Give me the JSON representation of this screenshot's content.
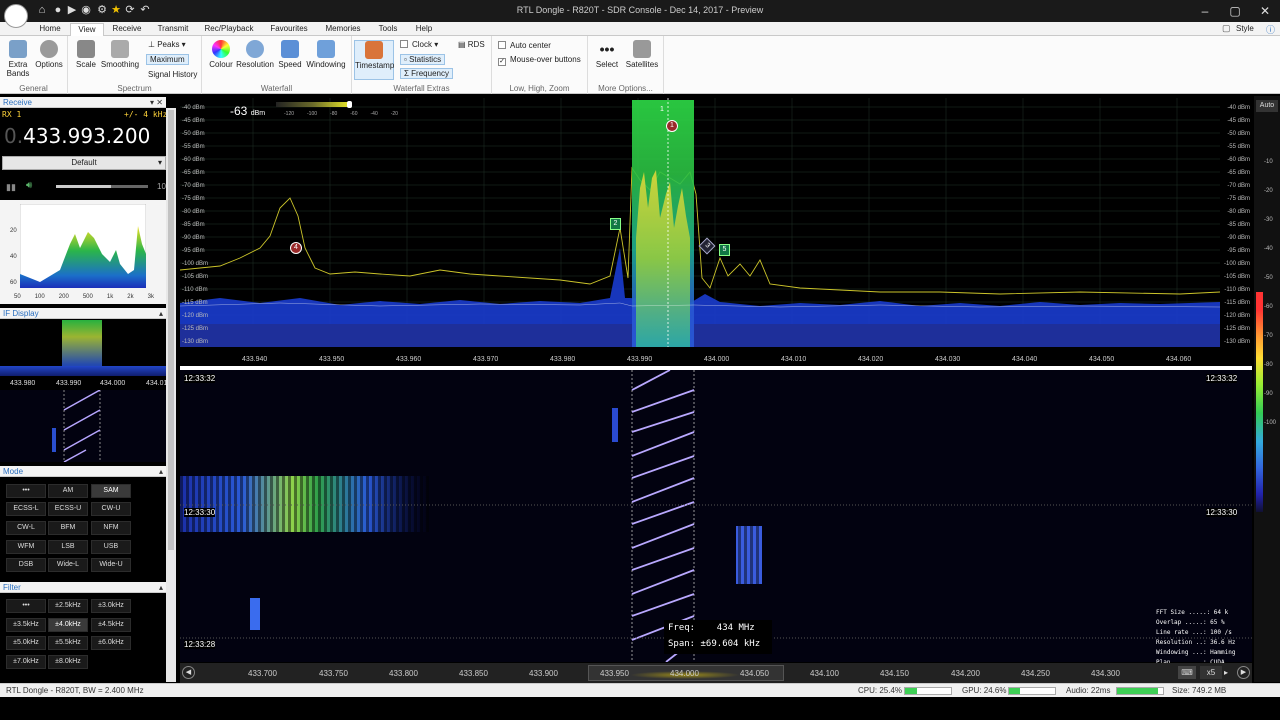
{
  "window": {
    "title": "RTL Dongle - R820T - SDR Console - Dec 14, 2017 - Preview"
  },
  "tabs": [
    "Home",
    "View",
    "Receive",
    "Transmit",
    "Rec/Playback",
    "Favourites",
    "Memories",
    "Tools",
    "Help"
  ],
  "active_tab": "View",
  "style_label": "Style",
  "ribbon": {
    "general": {
      "label": "General",
      "extra_bands": "Extra Bands",
      "options": "Options"
    },
    "spectrum": {
      "label": "Spectrum",
      "scale": "Scale",
      "smoothing": "Smoothing",
      "peaks": "Peaks",
      "maximum": "Maximum",
      "signal_history": "Signal History"
    },
    "waterfall": {
      "label": "Waterfall",
      "colour": "Colour",
      "resolution": "Resolution",
      "speed": "Speed",
      "windowing": "Windowing"
    },
    "waterfall_extras": {
      "label": "Waterfall Extras",
      "timestamp": "Timestamp",
      "clock": "Clock",
      "statistics": "Statistics",
      "frequency": "Frequency",
      "rds": "RDS"
    },
    "zoom": {
      "label": "Low, High, Zoom",
      "auto_center": "Auto center",
      "mouse_over": "Mouse-over buttons",
      "auto_center_checked": false,
      "mouse_over_checked": true
    },
    "more": {
      "label": "More Options...",
      "select": "Select",
      "satellites": "Satellites"
    }
  },
  "receive_panel": {
    "title": "Receive",
    "rx": "RX 1",
    "bandwidth": "+/- 4 kHz",
    "freq_dim": "0.",
    "freq": "433.993.200",
    "preset": "Default",
    "volume_max": "10",
    "audio_axis_y": [
      "20",
      "40",
      "60"
    ],
    "audio_axis_x": [
      "50",
      "100",
      "200",
      "500",
      "1k",
      "2k",
      "3k"
    ]
  },
  "if_display": {
    "title": "IF Display",
    "ticks": [
      "433.980",
      "433.990",
      "434.000",
      "434.01"
    ]
  },
  "mode": {
    "title": "Mode",
    "buttons": [
      "•••",
      "AM",
      "SAM",
      "ECSS-L",
      "ECSS-U",
      "CW-U",
      "CW-L",
      "BFM",
      "NFM",
      "WFM",
      "LSB",
      "USB",
      "DSB",
      "Wide-L",
      "Wide-U"
    ],
    "selected": "SAM"
  },
  "filter": {
    "title": "Filter",
    "buttons": [
      "•••",
      "±2.5kHz",
      "±3.0kHz",
      "±3.5kHz",
      "±4.0kHz",
      "±4.5kHz",
      "±5.0kHz",
      "±5.5kHz",
      "±6.0kHz",
      "±7.0kHz",
      "±8.0kHz"
    ],
    "selected": "±4.0kHz"
  },
  "spectrum": {
    "level_readout": "-63",
    "level_unit": "dBm",
    "meter_ticks": [
      "-120",
      "-100",
      "-80",
      "-60",
      "-40",
      "-20"
    ],
    "db_labels": [
      "-40 dBm",
      "-45 dBm",
      "-50 dBm",
      "-55 dBm",
      "-60 dBm",
      "-65 dBm",
      "-70 dBm",
      "-75 dBm",
      "-80 dBm",
      "-85 dBm",
      "-90 dBm",
      "-95 dBm",
      "-100 dBm",
      "-105 dBm",
      "-110 dBm",
      "-115 dBm",
      "-120 dBm",
      "-125 dBm",
      "-130 dBm"
    ],
    "freq_labels": [
      "433.940",
      "433.950",
      "433.960",
      "433.970",
      "433.980",
      "433.990",
      "434.000",
      "434.010",
      "434.020",
      "434.030",
      "434.040",
      "434.050",
      "434.060"
    ],
    "markers": [
      "1",
      "1",
      "2",
      "3",
      "4",
      "5"
    ],
    "auto": "Auto"
  },
  "waterfall": {
    "timestamps": [
      "12:33:32",
      "12:33:30",
      "12:33:28"
    ],
    "freq_label": "Freq:",
    "freq_value": "434 MHz",
    "span_label": "Span:",
    "span_value": "±69.604 kHz",
    "stats": [
      "FFT Size .....: 64 k",
      "Overlap .....: 65 %",
      "Line rate ...: 100 /s",
      "Resolution ..: 36.6 Hz",
      "Windowing ...: Hamming",
      "Plan ........: CUDA"
    ]
  },
  "scale_labels": [
    "-10",
    "-20",
    "-30",
    "-40",
    "-50",
    "-60",
    "-70",
    "-80",
    "-90",
    "-100"
  ],
  "freqbar": {
    "labels": [
      "433.700",
      "433.750",
      "433.800",
      "433.850",
      "433.900",
      "433.950",
      "434.000",
      "434.050",
      "434.100",
      "434.150",
      "434.200",
      "434.250",
      "434.300"
    ],
    "zoom": "x5"
  },
  "status": {
    "device": "RTL Dongle - R820T, BW = 2.400 MHz",
    "cpu": "CPU: 25.4%",
    "gpu": "GPU: 24.6%",
    "audio": "Audio: 22ms",
    "size": "Size: 749.2 MB",
    "cpu_level": 0.254,
    "gpu_level": 0.246
  },
  "colors": {
    "accent": "#2a6fbf",
    "band": "#22b43c",
    "trace": "#d7d02a",
    "noise": "#1a3ccf"
  }
}
